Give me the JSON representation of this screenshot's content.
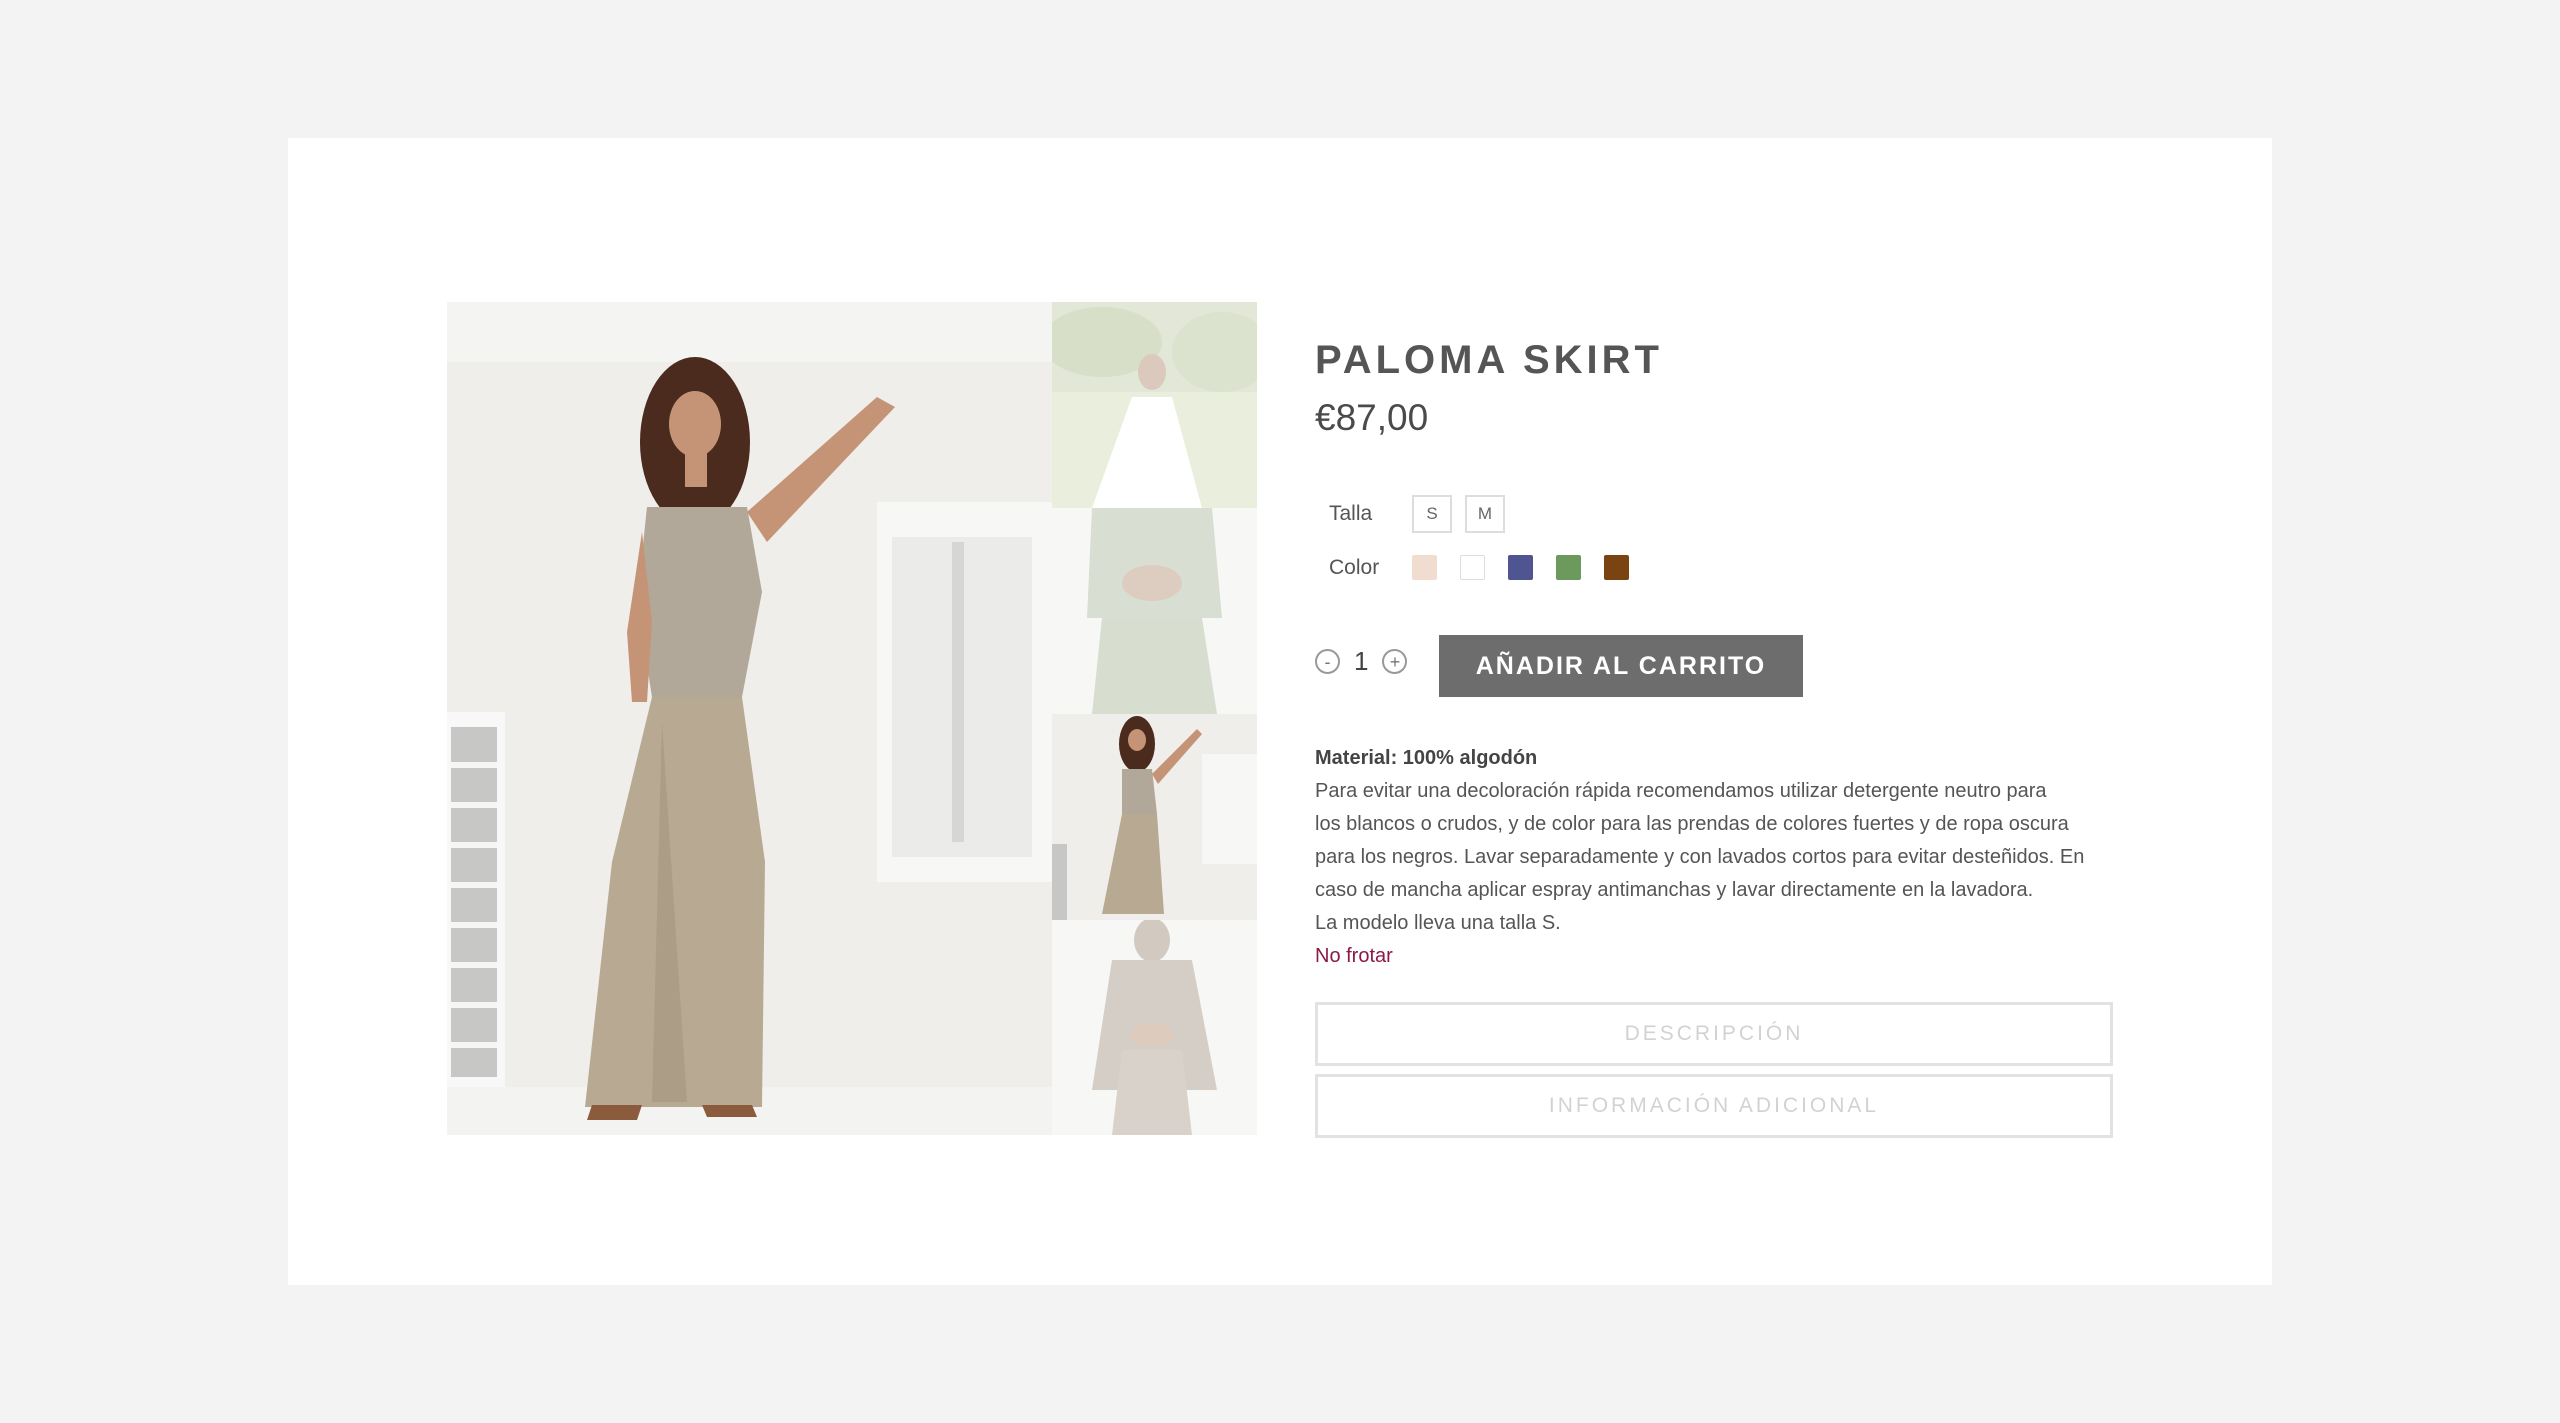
{
  "product": {
    "title": "PALOMA SKIRT",
    "price": "€87,00"
  },
  "size": {
    "label": "Talla",
    "options": [
      "S",
      "M"
    ]
  },
  "color": {
    "label": "Color",
    "swatches": [
      "#f1ddd0",
      "#ffffff",
      "#4e5590",
      "#6b9a5c",
      "#7a4412"
    ]
  },
  "quantity": {
    "minus": "-",
    "value": "1",
    "plus": "+"
  },
  "cart_button": "AÑADIR AL CARRITO",
  "description": {
    "material": "Material: 100% algodón",
    "lines": [
      "Para evitar una decoloración rápida recomendamos utilizar detergente neutro para",
      "los blancos o crudos, y de color para las prendas de colores fuertes y de ropa oscura",
      "para los negros. Lavar separadamente y con lavados cortos para evitar desteñidos. En",
      "caso de mancha aplicar espray antimanchas y lavar directamente en la lavadora.",
      "La modelo lleva una talla S."
    ],
    "warning": "No frotar"
  },
  "tabs": [
    "DESCRIPCIÓN",
    "INFORMACIÓN ADICIONAL"
  ],
  "icons": {
    "minus": "minus-circle-icon",
    "plus": "plus-circle-icon"
  }
}
